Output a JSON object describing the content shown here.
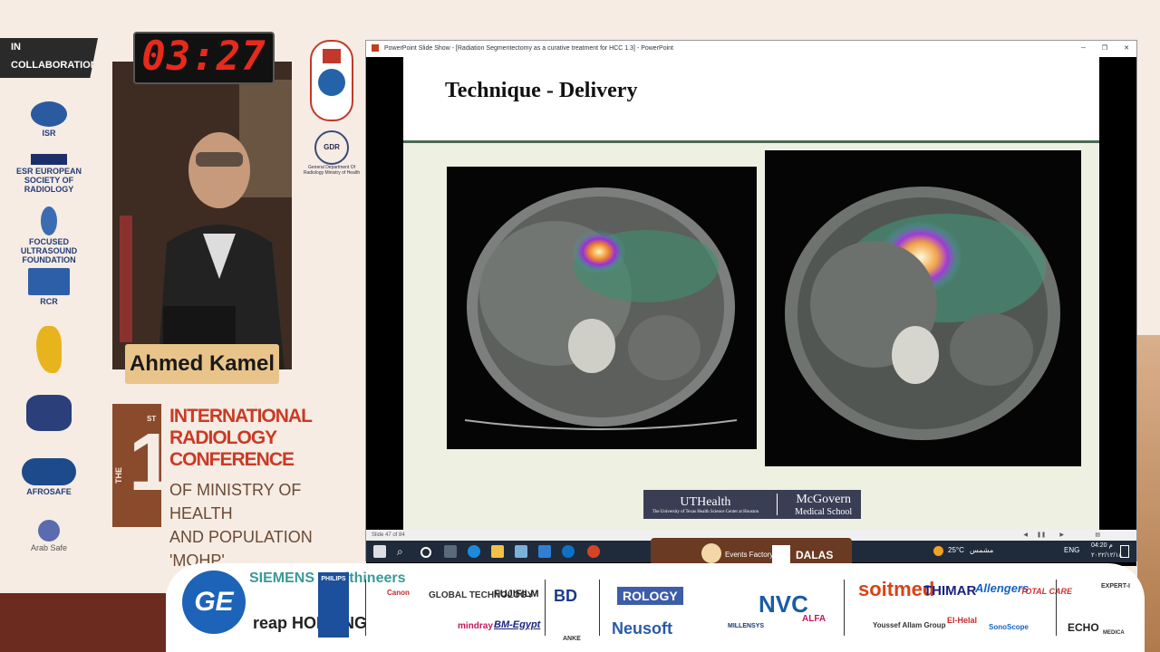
{
  "collab": {
    "header": "IN COLLABORATION WITH",
    "logos": [
      "ISR",
      "ESR EUROPEAN SOCIETY OF RADIOLOGY",
      "FOCUSED ULTRASOUND FOUNDATION",
      "RCR",
      "AFROSAFE",
      "Arab Safe"
    ]
  },
  "timer": "03:27",
  "speaker_name": "Ahmed Kamel",
  "conference": {
    "number": "1",
    "suffix": "ST",
    "the": "THE",
    "title_lines": [
      "INTERNATIONAL",
      "RADIOLOGY CONFERENCE"
    ],
    "sub_lines": [
      "OF MINISTRY OF HEALTH",
      "AND POPULATION 'MOHP'"
    ]
  },
  "gdr": {
    "label": "GDR",
    "text": "General Department Of Radiology Ministry of Health"
  },
  "ppt": {
    "window_title": "PowerPoint Slide Show - [Radiation Segmentectomy as a curative treatment for HCC 1.3] - PowerPoint",
    "slide_title": "Technique - Delivery",
    "footer_left": "UTHealth",
    "footer_left_sub": "The University of Texas Health Science Center at Houston",
    "footer_right": "McGovern",
    "footer_right_sub": "Medical School",
    "status": "Slide 47 of 84"
  },
  "taskbar": {
    "weather": "25°C",
    "weather_ar": "مشمس",
    "lang": "ENG",
    "time": "04:20 م",
    "date": "٢٠٢٢/١٢/١٨"
  },
  "events": {
    "label": "Events Factory",
    "brand": "DALAS"
  },
  "sponsors": [
    "GE",
    "SIEMENS Healthineers",
    "reap HOLDING",
    "PHILIPS",
    "Canon",
    "GLOBAL TECHNOLOGY",
    "FUJIFILM",
    "mindray",
    "BM-Egypt",
    "BD",
    "ANKE",
    "ROLOGY",
    "Neusoft",
    "MILLENSYS",
    "NVC",
    "ALFA",
    "soitmed",
    "THIMAR",
    "Allengers",
    "TOTAL CARE",
    "Youssef Allam Group",
    "El-Helal",
    "SonoScope",
    "ECHO",
    "EXPERT-I",
    "MEDICA"
  ]
}
